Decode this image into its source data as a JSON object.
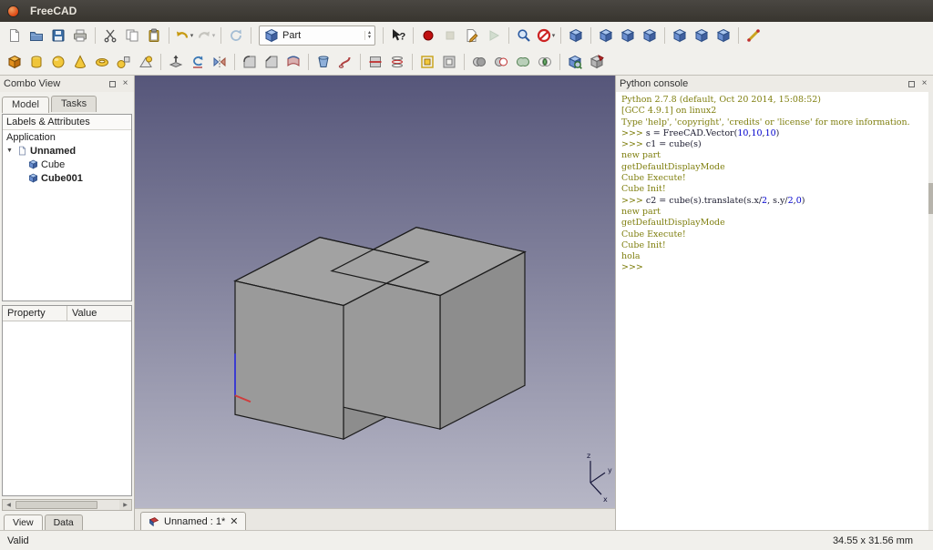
{
  "colors": {
    "viewport_top": "#56567a",
    "viewport_bottom": "#b7b7c6",
    "cube_top": "#a2a2a2",
    "cube_front": "#9a9a9a",
    "cube_side": "#8d8d8d",
    "console_msg": "#7f7f0f",
    "console_code": "#1c1c30",
    "console_num": "#0000cd",
    "accent_blue": "#3465a4"
  },
  "titlebar": {
    "title": "FreeCAD"
  },
  "toolbar": {
    "workbench": "Part",
    "row1": [
      {
        "name": "new-document",
        "icon": "page"
      },
      {
        "name": "open-document",
        "icon": "folder"
      },
      {
        "name": "save-document",
        "icon": "floppy"
      },
      {
        "name": "print-document",
        "icon": "printer"
      },
      {
        "sep": true
      },
      {
        "name": "cut",
        "icon": "scissors"
      },
      {
        "name": "copy",
        "icon": "copy"
      },
      {
        "name": "paste",
        "icon": "clipboard"
      },
      {
        "sep": true
      },
      {
        "name": "undo",
        "icon": "undo",
        "dropdown": true
      },
      {
        "name": "redo",
        "icon": "redo",
        "dropdown": true,
        "disabled": true
      },
      {
        "sep": true
      },
      {
        "name": "refresh",
        "icon": "refresh",
        "disabled": true
      },
      {
        "sep": true
      },
      {
        "combo": true,
        "name": "workbench-selector"
      },
      {
        "sep": true
      },
      {
        "name": "whats-this",
        "icon": "whatsthis"
      },
      {
        "sep": true
      },
      {
        "name": "macro-record",
        "icon": "record"
      },
      {
        "name": "macro-stop",
        "icon": "stop",
        "disabled": true
      },
      {
        "name": "macro-edit",
        "icon": "macroedit"
      },
      {
        "name": "macro-execute",
        "icon": "play",
        "disabled": true
      },
      {
        "sep": true
      },
      {
        "name": "fit-all",
        "icon": "magnifier"
      },
      {
        "name": "draw-style",
        "icon": "noentry",
        "dropdown": true
      },
      {
        "sep": true
      },
      {
        "name": "view-isometric",
        "icon": "cube"
      },
      {
        "sep": true
      },
      {
        "name": "view-front",
        "icon": "cube"
      },
      {
        "name": "view-top",
        "icon": "cube"
      },
      {
        "name": "view-right",
        "icon": "cube"
      },
      {
        "sep": true
      },
      {
        "name": "view-rear",
        "icon": "cube"
      },
      {
        "name": "view-bottom",
        "icon": "cube"
      },
      {
        "name": "view-left",
        "icon": "cube"
      },
      {
        "sep": true
      },
      {
        "name": "measure-distance",
        "icon": "measure"
      }
    ],
    "row2": [
      {
        "name": "part-box",
        "icon": "cubeorange"
      },
      {
        "name": "part-cylinder",
        "icon": "cylinder"
      },
      {
        "name": "part-sphere",
        "icon": "sphere"
      },
      {
        "name": "part-cone",
        "icon": "cone"
      },
      {
        "name": "part-torus",
        "icon": "torus"
      },
      {
        "name": "part-primitives",
        "icon": "primitives"
      },
      {
        "name": "part-shapebuilder",
        "icon": "shapebuilder"
      },
      {
        "sep": true
      },
      {
        "name": "part-extrude",
        "icon": "extrude"
      },
      {
        "name": "part-revolve",
        "icon": "revolve"
      },
      {
        "name": "part-mirror",
        "icon": "mirror"
      },
      {
        "sep": true
      },
      {
        "name": "part-fillet",
        "icon": "fillet"
      },
      {
        "name": "part-chamfer",
        "icon": "chamfer"
      },
      {
        "name": "part-ruled-surface",
        "icon": "ruled"
      },
      {
        "sep": true
      },
      {
        "name": "part-loft",
        "icon": "loft"
      },
      {
        "name": "part-sweep",
        "icon": "sweep"
      },
      {
        "sep": true
      },
      {
        "name": "part-section",
        "icon": "section"
      },
      {
        "name": "part-cross-sections",
        "icon": "xsections"
      },
      {
        "sep": true
      },
      {
        "name": "part-offset",
        "icon": "offset"
      },
      {
        "name": "part-thickness",
        "icon": "thickness"
      },
      {
        "sep": true
      },
      {
        "name": "part-boolean",
        "icon": "boolean"
      },
      {
        "name": "part-cut",
        "icon": "boolcut"
      },
      {
        "name": "part-union",
        "icon": "boolunion"
      },
      {
        "name": "part-common",
        "icon": "boolcommon"
      },
      {
        "sep": true
      },
      {
        "name": "part-check-geometry",
        "icon": "checkgeom"
      },
      {
        "name": "part-defeaturing",
        "icon": "defeaturing"
      }
    ]
  },
  "combo_view": {
    "title": "Combo View",
    "tabs": [
      {
        "label": "Model"
      },
      {
        "label": "Tasks"
      }
    ],
    "tree_header": "Labels & Attributes",
    "application_label": "Application",
    "document": "Unnamed",
    "items": [
      {
        "label": "Cube"
      },
      {
        "label": "Cube001"
      }
    ],
    "property_columns": [
      "Property",
      "Value"
    ],
    "bottom_tabs": [
      {
        "label": "View"
      },
      {
        "label": "Data"
      }
    ]
  },
  "viewport": {
    "doc_tab": "Unnamed : 1*",
    "axis_labels": [
      "z",
      "y",
      "x"
    ]
  },
  "console": {
    "title": "Python console",
    "lines": [
      [
        [
          "Python 2.7.8 (default, Oct 20 2014, 15:08:52)",
          "msg"
        ]
      ],
      [
        [
          "[GCC 4.9.1] on linux2",
          "msg"
        ]
      ],
      [
        [
          "Type 'help', 'copyright', 'credits' or 'license' for more information.",
          "msg"
        ]
      ],
      [
        [
          ">>> ",
          "msg"
        ],
        [
          "s = FreeCAD.Vector(",
          "code"
        ],
        [
          "10",
          "num"
        ],
        [
          ",",
          "code"
        ],
        [
          "10",
          "num"
        ],
        [
          ",",
          "code"
        ],
        [
          "10",
          "num"
        ],
        [
          ")",
          "code"
        ]
      ],
      [
        [
          ">>> ",
          "msg"
        ],
        [
          "c1 = cube(s)",
          "code"
        ]
      ],
      [
        [
          "new part",
          "msg"
        ]
      ],
      [
        [
          "getDefaultDisplayMode",
          "msg"
        ]
      ],
      [
        [
          "Cube Execute!",
          "msg"
        ]
      ],
      [
        [
          "Cube Init!",
          "msg"
        ]
      ],
      [
        [
          ">>> ",
          "msg"
        ],
        [
          "c2 = cube(s).translate(s.x/",
          "code"
        ],
        [
          "2",
          "num"
        ],
        [
          ", s.y/",
          "code"
        ],
        [
          "2",
          "num"
        ],
        [
          ",",
          "code"
        ],
        [
          "0",
          "num"
        ],
        [
          ")",
          "code"
        ]
      ],
      [
        [
          "new part",
          "msg"
        ]
      ],
      [
        [
          "getDefaultDisplayMode",
          "msg"
        ]
      ],
      [
        [
          "Cube Execute!",
          "msg"
        ]
      ],
      [
        [
          "Cube Init!",
          "msg"
        ]
      ],
      [
        [
          "hola",
          "msg"
        ]
      ],
      [
        [
          ">>>",
          "msg"
        ]
      ]
    ]
  },
  "statusbar": {
    "left": "Valid",
    "right": "34.55 x 31.56 mm"
  }
}
